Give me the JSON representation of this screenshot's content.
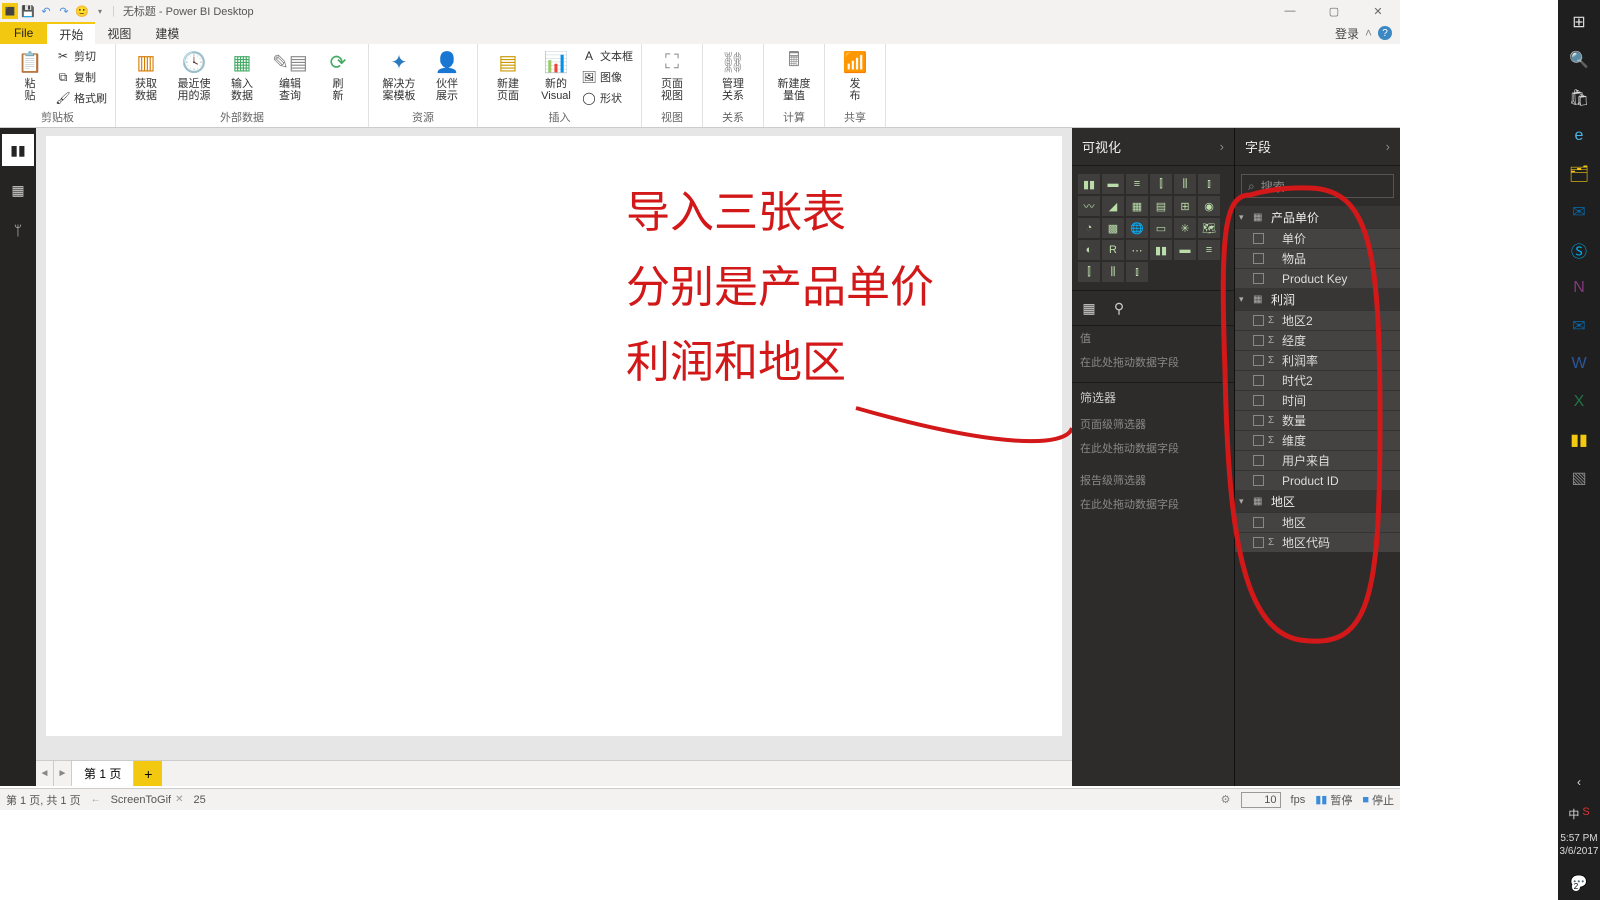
{
  "titlebar": {
    "doc_title": "无标题 - Power BI Desktop"
  },
  "ribbon_tabs": {
    "file": "File",
    "tabs": [
      "开始",
      "视图",
      "建模"
    ],
    "active_index": 0,
    "signin": "登录"
  },
  "ribbon": {
    "groups": {
      "clipboard": {
        "label": "剪贴板",
        "paste": "粘\n贴",
        "cut": "剪切",
        "copy": "复制",
        "format_painter": "格式刷"
      },
      "external_data": {
        "label": "外部数据",
        "get_data": "获取\n数据",
        "recent_sources": "最近使\n用的源",
        "enter_data": "输入\n数据",
        "edit_queries": "编辑\n查询",
        "refresh": "刷\n新"
      },
      "resources": {
        "label": "资源",
        "solution_templates": "解决方\n案模板",
        "partner_showcase": "伙伴\n展示"
      },
      "insert": {
        "label": "插入",
        "new_page": "新建\n页面",
        "new_visual": "新的\nVisual",
        "text_box": "文本框",
        "image": "图像",
        "shapes": "形状"
      },
      "view": {
        "label": "视图",
        "page_view": "页面\n视图"
      },
      "relationships": {
        "label": "关系",
        "manage_relationships": "管理\n关系"
      },
      "calculations": {
        "label": "计算",
        "new_measure": "新建度\n量值"
      },
      "share": {
        "label": "共享",
        "publish": "发\n布"
      }
    }
  },
  "leftrail": {
    "icons": [
      "report-icon",
      "data-icon",
      "model-icon"
    ],
    "active": 0
  },
  "annotation": {
    "line1": "导入三张表",
    "line2": "分别是产品单价",
    "line3": "利润和地区"
  },
  "viz_pane": {
    "title": "可视化",
    "values_label": "值",
    "values_drop": "在此处拖动数据字段",
    "filters_label": "筛选器",
    "page_filters": "页面级筛选器",
    "page_filters_drop": "在此处拖动数据字段",
    "report_filters": "报告级筛选器",
    "report_filters_drop": "在此处拖动数据字段"
  },
  "fields_pane": {
    "title": "字段",
    "search_placeholder": "搜索",
    "tables": [
      {
        "name": "产品单价",
        "fields": [
          {
            "name": "单价",
            "sigma": false
          },
          {
            "name": "物品",
            "sigma": false
          },
          {
            "name": "Product Key",
            "sigma": false
          }
        ]
      },
      {
        "name": "利润",
        "fields": [
          {
            "name": "地区2",
            "sigma": true
          },
          {
            "name": "经度",
            "sigma": true
          },
          {
            "name": "利润率",
            "sigma": true
          },
          {
            "name": "时代2",
            "sigma": false
          },
          {
            "name": "时间",
            "sigma": false
          },
          {
            "name": "数量",
            "sigma": true
          },
          {
            "name": "维度",
            "sigma": true
          },
          {
            "name": "用户来自",
            "sigma": false
          },
          {
            "name": "Product ID",
            "sigma": false
          }
        ]
      },
      {
        "name": "地区",
        "fields": [
          {
            "name": "地区",
            "sigma": false
          },
          {
            "name": "地区代码",
            "sigma": true
          }
        ]
      }
    ]
  },
  "page_tabs": {
    "page1": "第 1 页"
  },
  "statusbar": {
    "page_info": "第 1 页, 共 1 页",
    "stg_label": "ScreenToGif",
    "stg_x": "25",
    "fps_value": "10",
    "fps_label": "fps",
    "pause": "暂停",
    "stop": "停止"
  },
  "taskbar": {
    "lang_cn": "中",
    "time": "5:57 PM",
    "date": "3/6/2017"
  }
}
